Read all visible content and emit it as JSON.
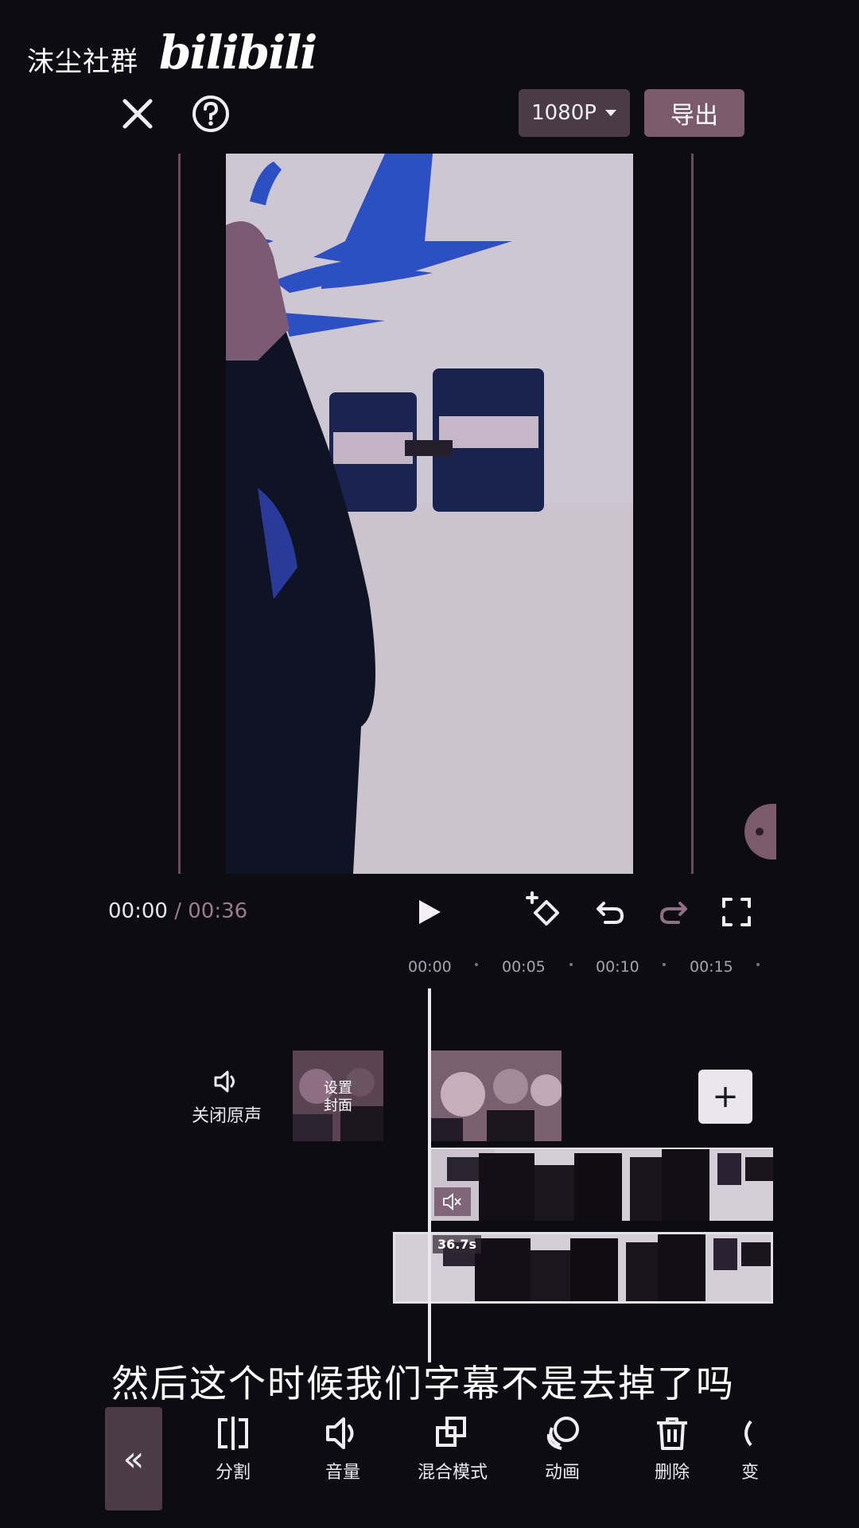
{
  "watermark": {
    "text": "沫尘社群",
    "logo": "bilibili"
  },
  "topbar": {
    "close_icon": "close-icon",
    "help_icon": "help-icon",
    "resolution": "1080P",
    "export_label": "导出"
  },
  "player": {
    "current_time": "00:00",
    "separator": "/",
    "total_time": "00:36",
    "icons": [
      "play-icon",
      "keyframe-add-icon",
      "undo-icon",
      "redo-icon",
      "fullscreen-icon"
    ]
  },
  "timeline": {
    "ruler": [
      "00:00",
      "00:05",
      "00:10",
      "00:15"
    ],
    "mute_label": "关闭原声",
    "cover_label_line1": "设置",
    "cover_label_line2": "封面",
    "add_clip": "+",
    "clip_duration": "36.7s"
  },
  "subtitle": "然后这个时候我们字幕不是去掉了吗",
  "toolbar": {
    "collapse": "«",
    "items": [
      {
        "label": "分割",
        "icon": "split-icon"
      },
      {
        "label": "音量",
        "icon": "volume-icon"
      },
      {
        "label": "混合模式",
        "icon": "blend-mode-icon"
      },
      {
        "label": "动画",
        "icon": "animation-icon"
      },
      {
        "label": "删除",
        "icon": "delete-icon"
      },
      {
        "label": "变",
        "icon": "more-icon"
      }
    ]
  },
  "colors": {
    "accent": "#7c5a6d",
    "background": "#0d0c12"
  }
}
